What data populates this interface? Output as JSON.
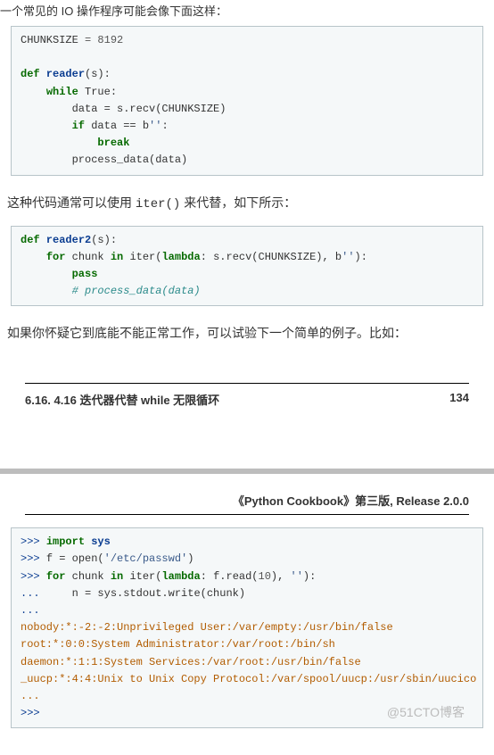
{
  "intro_top": "一个常见的 IO 操作程序可能会像下面这样：",
  "code1": {
    "l1_a": "CHUNKSIZE ",
    "l1_b": "= ",
    "l1_c": "8192",
    "l2_a": "def",
    "l2_b": " reader",
    "l2_c": "(s):",
    "l3_a": "    ",
    "l3_b": "while",
    "l3_c": " True:",
    "l4": "        data = s.recv(CHUNKSIZE)",
    "l5_a": "        ",
    "l5_b": "if",
    "l5_c": " data == b",
    "l5_d": "''",
    "l5_e": ":",
    "l6_a": "            ",
    "l6_b": "break",
    "l7": "        process_data(data)"
  },
  "para1_a": "这种代码通常可以使用 ",
  "para1_mono": "iter()",
  "para1_b": " 来代替，如下所示：",
  "code2": {
    "l1_a": "def",
    "l1_b": " reader2",
    "l1_c": "(s):",
    "l2_a": "    ",
    "l2_b": "for",
    "l2_c": " chunk ",
    "l2_d": "in",
    "l2_e": " iter(",
    "l2_f": "lambda",
    "l2_g": ": s.recv(CHUNKSIZE), b",
    "l2_h": "''",
    "l2_i": "):",
    "l3_a": "        ",
    "l3_b": "pass",
    "l4_a": "        ",
    "l4_b": "# process_data(data)"
  },
  "para2": "如果你怀疑它到底能不能正常工作，可以试验下一个简单的例子。比如：",
  "footer_left": "6.16.  4.16 迭代器代替 while 无限循环",
  "footer_right": "134",
  "header2": "《Python Cookbook》第三版, Release 2.0.0",
  "code3": {
    "p": ">>> ",
    "pd": "... ",
    "l1_b": "import",
    "l1_c": " sys",
    "l2_a": "f = open(",
    "l2_b": "'/etc/passwd'",
    "l2_c": ")",
    "l3_b": "for",
    "l3_c": " chunk ",
    "l3_d": "in",
    "l3_e": " iter(",
    "l3_f": "lambda",
    "l3_g": ": f.read(",
    "l3_h": "10",
    "l3_i": "), ",
    "l3_j": "''",
    "l3_k": "):",
    "l4": "    n = sys.stdout.write(chunk)",
    "o1": "nobody:*:-2:-2:Unprivileged User:/var/empty:/usr/bin/false",
    "o2": "root:*:0:0:System Administrator:/var/root:/bin/sh",
    "o3": "daemon:*:1:1:System Services:/var/root:/usr/bin/false",
    "o4": "_uucp:*:4:4:Unix to Unix Copy Protocol:/var/spool/uucp:/usr/sbin/uucico",
    "o5": "...",
    "l9": ">>>"
  },
  "watermark": "@51CTO博客"
}
